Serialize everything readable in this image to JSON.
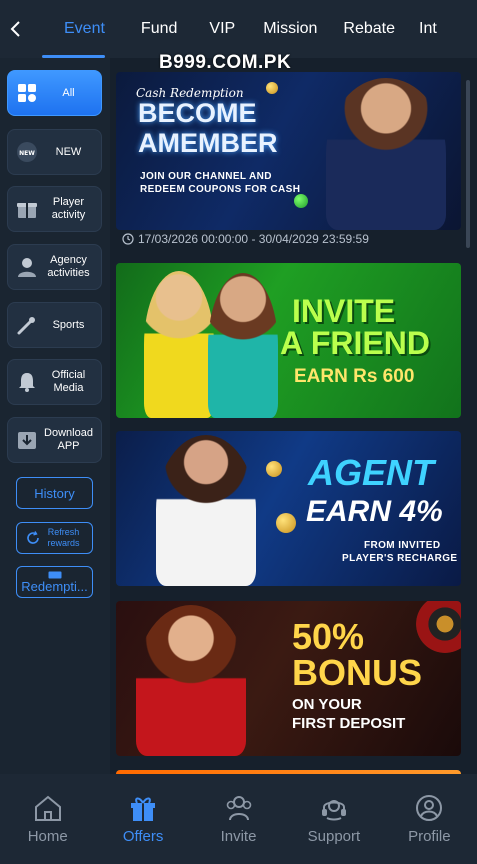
{
  "topnav": {
    "back_icon": "chevron-left-icon",
    "tabs": [
      {
        "label": "Event",
        "active": true
      },
      {
        "label": "Fund"
      },
      {
        "label": "VIP"
      },
      {
        "label": "Mission"
      },
      {
        "label": "Rebate"
      },
      {
        "label": "Int"
      }
    ]
  },
  "watermark": "B999.COM.PK",
  "sidebar": {
    "categories": [
      {
        "label": "All",
        "icon": "grid-icon",
        "active": true
      },
      {
        "label": "NEW",
        "icon": "new-badge-icon"
      },
      {
        "label": "Player activity",
        "icon": "gift-icon"
      },
      {
        "label": "Agency activities",
        "icon": "agent-icon"
      },
      {
        "label": "Sports",
        "icon": "sports-icon"
      },
      {
        "label": "Official Media",
        "icon": "bell-icon"
      },
      {
        "label": "Download APP",
        "icon": "download-icon"
      }
    ],
    "buttons": {
      "history": "History",
      "refresh": "Refresh rewards",
      "redemption": "Redempti..."
    }
  },
  "banners": [
    {
      "small_text": "Cash Redemption",
      "line1": "BECOME",
      "line2": "AMEMBER",
      "sub1": "JOIN OUR CHANNEL AND",
      "sub2": "REDEEM COUPONS FOR CASH",
      "date": "17/03/2026 00:00:00 - 30/04/2029 23:59:59"
    },
    {
      "line1": "INVITE",
      "line2": "A FRIEND",
      "sub1": "EARN Rs 600"
    },
    {
      "line1": "AGENT",
      "line2": "EARN 4%",
      "sub1": "FROM INVITED",
      "sub2": "PLAYER'S RECHARGE"
    },
    {
      "line1": "50%",
      "line2": "BONUS",
      "sub1": "ON YOUR",
      "sub2": "FIRST DEPOSIT"
    }
  ],
  "bottomnav": [
    {
      "label": "Home",
      "icon": "home-icon"
    },
    {
      "label": "Offers",
      "icon": "gift-box-icon",
      "active": true
    },
    {
      "label": "Invite",
      "icon": "invite-icon"
    },
    {
      "label": "Support",
      "icon": "headset-icon"
    },
    {
      "label": "Profile",
      "icon": "profile-icon"
    }
  ],
  "colors": {
    "accent": "#3e8ef7",
    "background": "#16202c",
    "nav": "#1d2835"
  }
}
